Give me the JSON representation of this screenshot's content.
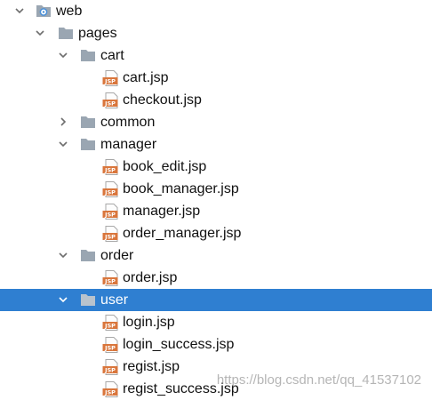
{
  "tree": {
    "root": "web",
    "pages": "pages",
    "cart": {
      "label": "cart",
      "files": [
        "cart.jsp",
        "checkout.jsp"
      ]
    },
    "common": {
      "label": "common"
    },
    "manager": {
      "label": "manager",
      "files": [
        "book_edit.jsp",
        "book_manager.jsp",
        "manager.jsp",
        "order_manager.jsp"
      ]
    },
    "order": {
      "label": "order",
      "files": [
        "order.jsp"
      ]
    },
    "user": {
      "label": "user",
      "files": [
        "login.jsp",
        "login_success.jsp",
        "regist.jsp",
        "regist_success.jsp"
      ]
    }
  },
  "file_badge": "JSP",
  "watermark": "https://blog.csdn.net/qq_41537102",
  "colors": {
    "selection": "#2f7fd1",
    "folder": "#9aa6b2",
    "jsp_badge": "#d9763c",
    "root_icon": "#4a90d9"
  }
}
